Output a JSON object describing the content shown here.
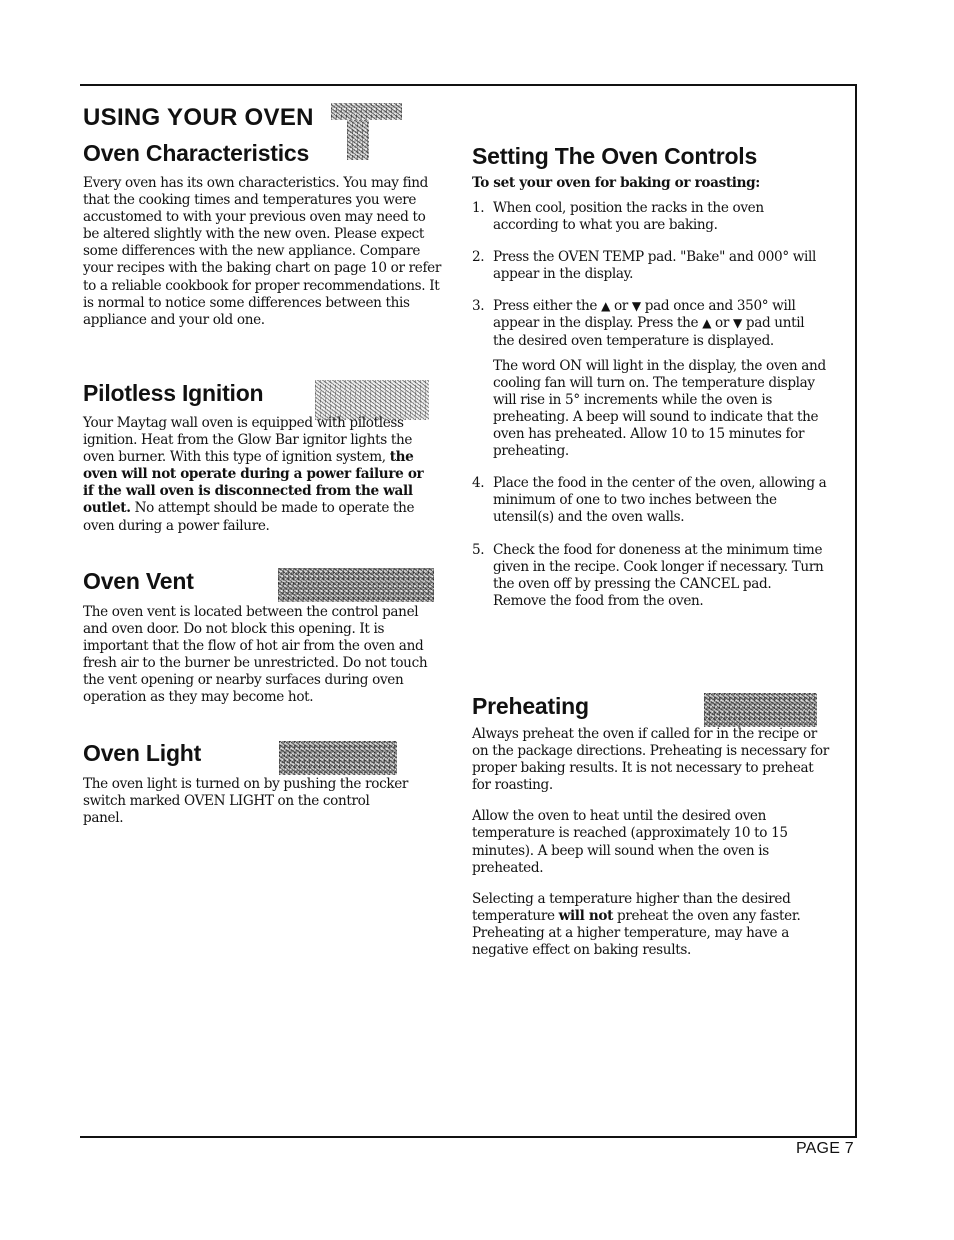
{
  "page": {
    "number_label": "PAGE 7"
  },
  "left_column": {
    "chapter_title": "USING YOUR OVEN",
    "sections": [
      {
        "title": "Oven Characteristics",
        "paragraphs": [
          "Every oven has its own characteristics. You may find that the cooking times and temperatures you were accustomed to with your previous oven may need to be altered slightly with the new oven. Please expect some differences with the new appliance. Compare your recipes with the baking chart on page 10 or refer to a reliable cookbook for proper recommendations. It is normal to notice some differences between this appliance and your old one."
        ]
      },
      {
        "title": "Pilotless Ignition",
        "text_before_bold": "Your Maytag wall oven is equipped with pilotless ignition. Heat from the Glow Bar ignitor lights the oven burner. With this type of ignition system, ",
        "bold_text": "the oven will not operate during a power failure or if the wall oven is disconnected from the wall outlet.",
        "text_after_bold": " No attempt should be made to operate the oven during a power failure."
      },
      {
        "title": "Oven Vent",
        "paragraphs": [
          "The oven vent is located between the control panel and oven door. Do not block this opening. It is important that the flow of hot air from the oven and fresh air to the burner be unrestricted. Do not touch the vent opening or nearby surfaces during oven operation as they may become hot."
        ]
      },
      {
        "title": "Oven Light",
        "paragraphs": [
          "The oven light is turned on by pushing the rocker switch marked OVEN LIGHT on the control panel."
        ]
      }
    ]
  },
  "right_column": {
    "controls": {
      "title": "Setting The Oven Controls",
      "intro": "To set your oven for baking or roasting:",
      "steps": [
        {
          "num": "1.",
          "text": "When cool, position the racks in the oven according to what you are baking."
        },
        {
          "num": "2.",
          "text": "Press the OVEN TEMP pad. \"Bake\" and 000° will appear in the display."
        },
        {
          "num": "3.",
          "part1": "Press either the ",
          "up": "▲",
          "or1": " or ",
          "down": "▼",
          "part2": " pad once and 350° will appear in the display. Press the ",
          "up2": "▲",
          "or2": " or ",
          "down2": "▼",
          "part3": " pad until the desired oven temperature is displayed.",
          "note": "The word ON will light in the display, the oven and cooling fan will turn on. The temperature display will rise in 5° increments while the oven is preheating. A beep will sound to indicate that the oven has preheated. Allow 10 to 15 minutes for preheating."
        },
        {
          "num": "4.",
          "text": "Place the food in the center of the oven, allowing a minimum of one to two inches between the utensil(s) and the oven walls."
        },
        {
          "num": "5.",
          "text": "Check the food for doneness at the minimum time given in the recipe. Cook longer if necessary. Turn the oven off by pressing the CANCEL pad. Remove the food from the oven."
        }
      ]
    },
    "preheating": {
      "title": "Preheating",
      "p1": "Always preheat the oven if called for in the recipe or on the package directions. Preheating is necessary for proper baking results. It is not necessary to preheat for roasting.",
      "p2": "Allow the oven to heat until the desired oven temperature is reached (approximately 10 to 15 minutes). A beep will sound when the oven is preheated.",
      "p3_before": "Selecting a temperature higher than the desired temperature ",
      "p3_bold": "will not",
      "p3_after": " preheat the oven any faster. Preheating at a higher temperature, may have a negative effect on baking results."
    }
  }
}
